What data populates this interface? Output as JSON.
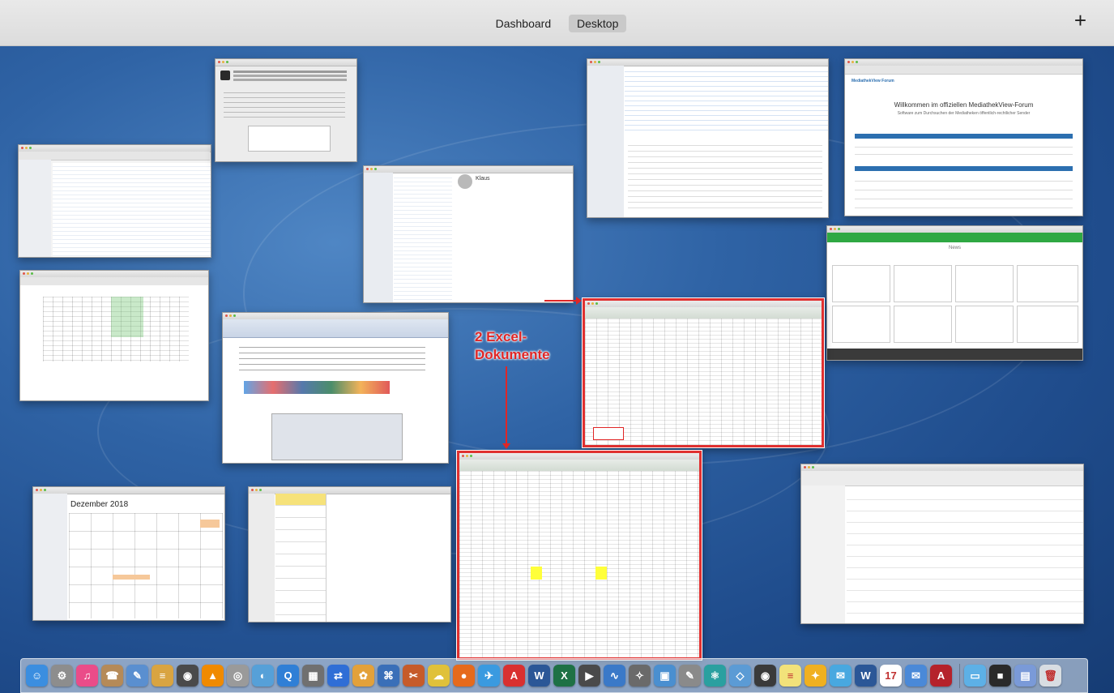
{
  "mission_control": {
    "spaces": [
      "Dashboard",
      "Desktop"
    ],
    "active_space": "Desktop",
    "add_space_label": "+"
  },
  "windows": {
    "calendar": {
      "month_title": "Dezember 2018"
    },
    "forum": {
      "heading": "Willkommen im offiziellen MediathekView-Forum",
      "subheading": "Software zum Durchsuchen der Mediatheken öffentlich-rechtlicher Sender",
      "brand": "MediathekView Forum"
    },
    "mail_reader": {
      "sender": "Klaus"
    },
    "news": {
      "title": "News"
    }
  },
  "annotation": {
    "line1": "2 Excel-",
    "line2": "Dokumente"
  },
  "colors": {
    "highlight": "#e02626",
    "excel_green": "#1e7145",
    "wallpaper": "#2f63a5"
  },
  "dock": {
    "icons": [
      {
        "name": "finder-icon",
        "color": "#3b8ee0",
        "glyph": "☺"
      },
      {
        "name": "system-preferences-icon",
        "color": "#8d8d8d",
        "glyph": "⚙"
      },
      {
        "name": "itunes-icon",
        "color": "#ea4c89",
        "glyph": "♫"
      },
      {
        "name": "contacts-icon",
        "color": "#b58a58",
        "glyph": "☎"
      },
      {
        "name": "preview-icon",
        "color": "#5a8fd0",
        "glyph": "✎"
      },
      {
        "name": "notes-icon",
        "color": "#d9a441",
        "glyph": "≡"
      },
      {
        "name": "dvd-player-icon",
        "color": "#4a4a4a",
        "glyph": "◉"
      },
      {
        "name": "vlc-icon",
        "color": "#f08a00",
        "glyph": "▲"
      },
      {
        "name": "disk-utility-icon",
        "color": "#9a9a9a",
        "glyph": "◎"
      },
      {
        "name": "screenshot-icon",
        "color": "#56a0d8",
        "glyph": "◐"
      },
      {
        "name": "quicktime-icon",
        "color": "#2f7fd6",
        "glyph": "Q"
      },
      {
        "name": "calculator-icon",
        "color": "#707070",
        "glyph": "▦"
      },
      {
        "name": "teamviewer-icon",
        "color": "#2f6ed6",
        "glyph": "⇄"
      },
      {
        "name": "photos-icon",
        "color": "#e3a13a",
        "glyph": "✿"
      },
      {
        "name": "network-icon",
        "color": "#3a6fb8",
        "glyph": "⌘"
      },
      {
        "name": "tools-icon",
        "color": "#c65b2a",
        "glyph": "✂"
      },
      {
        "name": "cloud-icon",
        "color": "#e0c13a",
        "glyph": "☁"
      },
      {
        "name": "firefox-icon",
        "color": "#e66a1c",
        "glyph": "●"
      },
      {
        "name": "safari-icon",
        "color": "#3a9ae0",
        "glyph": "✈"
      },
      {
        "name": "acrobat-icon",
        "color": "#d93030",
        "glyph": "A"
      },
      {
        "name": "word-icon",
        "color": "#2b5797",
        "glyph": "W"
      },
      {
        "name": "excel-icon",
        "color": "#1e7145",
        "glyph": "X"
      },
      {
        "name": "imovie-icon",
        "color": "#4a4a4a",
        "glyph": "▶"
      },
      {
        "name": "activity-monitor-icon",
        "color": "#3a79c8",
        "glyph": "∿"
      },
      {
        "name": "automator-icon",
        "color": "#6a6a6a",
        "glyph": "✧"
      },
      {
        "name": "image-capture-icon",
        "color": "#4a8fd0",
        "glyph": "▣"
      },
      {
        "name": "photo-booth-icon",
        "color": "#8a8a8a",
        "glyph": "✎"
      },
      {
        "name": "atom-icon",
        "color": "#2aa0a0",
        "glyph": "⚛"
      },
      {
        "name": "keynote-icon",
        "color": "#5b9bd5",
        "glyph": "◇"
      },
      {
        "name": "wifi-icon",
        "color": "#3a3a3a",
        "glyph": "◉"
      },
      {
        "name": "stickies-icon",
        "color": "#f2e27a",
        "glyph": "≡"
      },
      {
        "name": "compass-icon",
        "color": "#f0b020",
        "glyph": "✦"
      },
      {
        "name": "messages-icon",
        "color": "#48a8e0",
        "glyph": "✉"
      },
      {
        "name": "word-doc-icon",
        "color": "#2b5797",
        "glyph": "W"
      },
      {
        "name": "calendar-icon",
        "color": "#ffffff",
        "glyph": "17"
      },
      {
        "name": "mail-icon",
        "color": "#4a89d8",
        "glyph": "✉"
      },
      {
        "name": "acrobat-reader-icon",
        "color": "#b5222b",
        "glyph": "A"
      }
    ],
    "right_icons": [
      {
        "name": "downloads-folder-icon",
        "color": "#5db0e6",
        "glyph": "▭"
      },
      {
        "name": "display-icon",
        "color": "#2a2a2a",
        "glyph": "■"
      },
      {
        "name": "document-stack-icon",
        "color": "#7a9ad8",
        "glyph": "▤"
      },
      {
        "name": "trash-icon",
        "color": "#d8dde2",
        "glyph": "🗑"
      }
    ]
  }
}
